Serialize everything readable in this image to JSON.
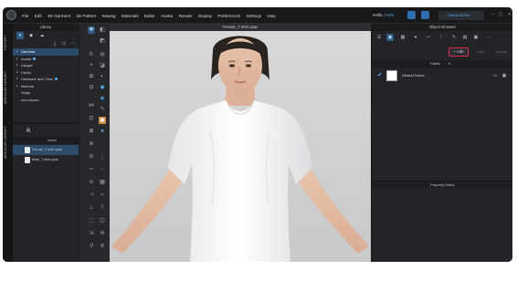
{
  "app": {
    "menu": [
      "File",
      "Edit",
      "3D Garment",
      "2D Pattern",
      "Sewing",
      "Materials",
      "Editor",
      "Avatar",
      "Render",
      "Display",
      "Preferences",
      "Settings",
      "Help"
    ],
    "greeting": "Hello, ",
    "user": "Fumi",
    "mode_label": "SIMULATION",
    "window_controls": [
      "–",
      "▢",
      "✕"
    ]
  },
  "side_tabs": [
    "HISTORY",
    "MODULAR LIBRARY",
    "MODULAR LIBRARY"
  ],
  "library": {
    "title": "Library",
    "tree": [
      {
        "label": "Garment",
        "selected": true,
        "dot": false
      },
      {
        "label": "Avatar",
        "selected": false,
        "dot": true
      },
      {
        "label": "Hanger",
        "selected": false,
        "dot": false
      },
      {
        "label": "Fabric",
        "selected": false,
        "dot": false
      },
      {
        "label": "Hardware and Trims",
        "selected": false,
        "dot": true
      },
      {
        "label": "Material",
        "selected": false,
        "dot": false
      },
      {
        "label": "Stage",
        "selected": false,
        "dot": false
      },
      {
        "label": "new assets",
        "selected": false,
        "dot": false
      }
    ],
    "column_header": "Name",
    "files": [
      {
        "label": "Female_T-shirt.zpac",
        "selected": true
      },
      {
        "label": "Male_T-shirt.zpac",
        "selected": false
      }
    ]
  },
  "viewport": {
    "title": "Female_T-shirt.zpac"
  },
  "object_browser": {
    "title": "Object Browser",
    "add_label": "+ Add",
    "copy_label": "Copy",
    "assign_label": "Assign",
    "section_label": "Fabric",
    "fabric_name": "Default Fabric",
    "fabric_color": "#ffffff"
  },
  "property_editor": {
    "title": "Property Editor"
  },
  "colors": {
    "accent": "#5ab2ff",
    "highlight_outline": "#d6334a",
    "panel_bg": "#232427"
  }
}
